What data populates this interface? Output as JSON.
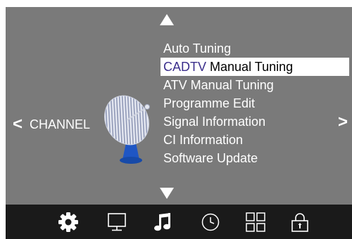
{
  "menu": {
    "category_label": "CHANNEL",
    "items": [
      {
        "label": "Auto Tuning",
        "prefix": ""
      },
      {
        "label": "Manual Tuning",
        "prefix": "CADTV",
        "selected": true
      },
      {
        "label": "ATV Manual Tuning",
        "prefix": ""
      },
      {
        "label": "Programme Edit",
        "prefix": ""
      },
      {
        "label": "Signal Information",
        "prefix": ""
      },
      {
        "label": "CI Information",
        "prefix": ""
      },
      {
        "label": "Software Update",
        "prefix": ""
      }
    ]
  },
  "nav": {
    "left_glyph": "<",
    "right_glyph": ">"
  },
  "bottom_bar": {
    "icons": [
      {
        "name": "settings-gear-icon",
        "active": true
      },
      {
        "name": "picture-monitor-icon",
        "active": false
      },
      {
        "name": "sound-music-icon",
        "active": true
      },
      {
        "name": "time-clock-icon",
        "active": false
      },
      {
        "name": "options-grid-icon",
        "active": false
      },
      {
        "name": "lock-icon",
        "active": false
      }
    ]
  },
  "colors": {
    "panel_bg": "#7a7a7a",
    "bar_bg": "#1a1a1a",
    "selected_bg": "#ffffff",
    "highlight_text": "#3b2f8c"
  }
}
